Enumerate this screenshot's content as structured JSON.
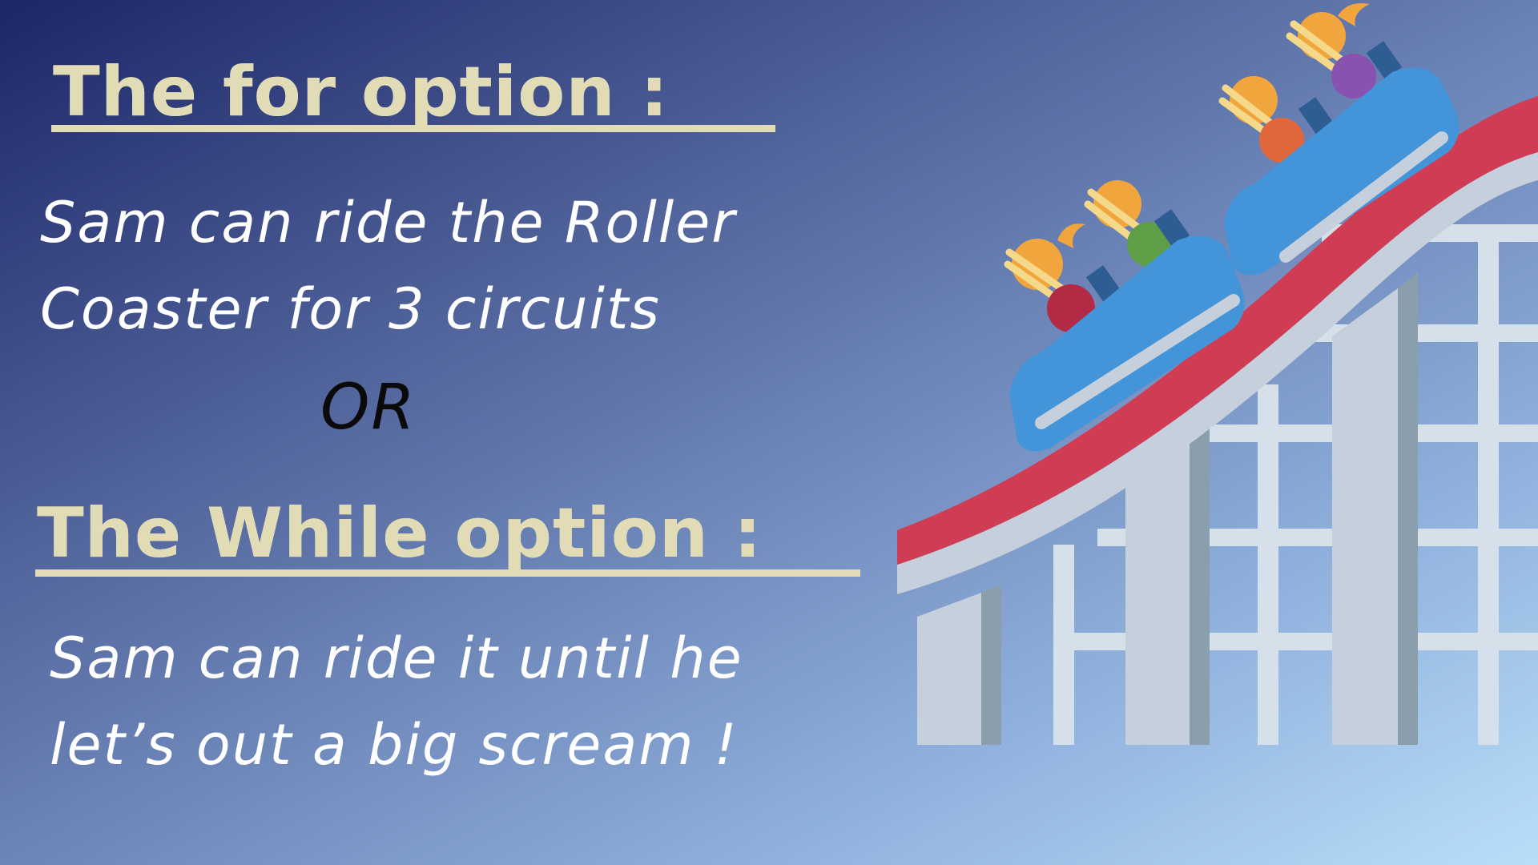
{
  "slide": {
    "for_heading": "The for option :",
    "for_description": [
      "Sam can ride the Roller",
      "Coaster for 3 circuits"
    ],
    "or_label": "OR",
    "while_heading": "The While option :",
    "while_description": [
      "Sam can ride it until he",
      "let’s out a big scream !"
    ]
  },
  "illustration": {
    "name": "roller-coaster-icon",
    "colors": {
      "track": "#d13c55",
      "cars": "#4394d8",
      "structure": "#c5d0dc",
      "heading": "#e2dcb6"
    }
  }
}
